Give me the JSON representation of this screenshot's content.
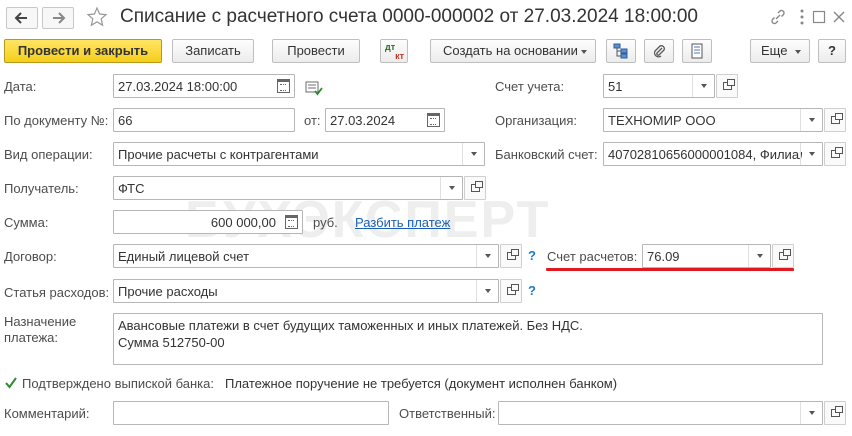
{
  "header": {
    "title": "Списание с расчетного счета 0000-000002 от 27.03.2024 18:00:00",
    "back_icon": "arrow-left-icon",
    "forward_icon": "arrow-right-icon",
    "favorite_icon": "star-icon",
    "link_icon": "link-icon",
    "more_icon": "vertical-dots-icon",
    "maximize_icon": "maximize-icon",
    "close_icon": "close-icon"
  },
  "toolbar": {
    "post_close_label": "Провести и закрыть",
    "write_label": "Записать",
    "post_label": "Провести",
    "dt_kt_label_top": "дт",
    "dt_kt_label_bottom": "кт",
    "create_based_label": "Создать на основании",
    "more_label": "Еще",
    "help_label": "?"
  },
  "form": {
    "date": {
      "label": "Дата:",
      "value": "27.03.2024 18:00:00"
    },
    "doc_number": {
      "label": "По документу №:",
      "value": "66"
    },
    "doc_date": {
      "label": "от:",
      "value": "27.03.2024"
    },
    "account": {
      "label": "Счет учета:",
      "value": "51"
    },
    "organization": {
      "label": "Организация:",
      "value": "ТЕХНОМИР ООО"
    },
    "operation_type": {
      "label": "Вид операции:",
      "value": "Прочие расчеты с контрагентами"
    },
    "bank_account": {
      "label": "Банковский счет:",
      "value": "40702810656000001084, Филиал"
    },
    "recipient": {
      "label": "Получатель:",
      "value": "ФТС"
    },
    "amount": {
      "label": "Сумма:",
      "value": "600 000,00",
      "currency": "руб.",
      "split_link": "Разбить платеж"
    },
    "contract": {
      "label": "Договор:",
      "value": "Единый лицевой счет",
      "help": "?"
    },
    "settlement_account": {
      "label": "Счет расчетов:",
      "value": "76.09"
    },
    "expense_item": {
      "label": "Статья расходов:",
      "value": "Прочие расходы",
      "help": "?"
    },
    "purpose": {
      "label_line1": "Назначение",
      "label_line2": "платежа:",
      "line1": "Авансовые платежи в счет будущих таможенных и иных платежей. Без НДС.",
      "line2": "Сумма 512750-00"
    },
    "bank_confirmed": {
      "label": "Подтверждено выпиской банка:",
      "checked": true,
      "note": "Платежное поручение не требуется (документ исполнен банком)"
    },
    "comment": {
      "label": "Комментарий:",
      "value": ""
    },
    "responsible": {
      "label": "Ответственный:",
      "value": ""
    }
  },
  "watermark": "БУХЭКСПЕРТ",
  "colors": {
    "accent_yellow": "#f5ce1a",
    "highlight_red": "#e0191f",
    "link_blue": "#1a5fb4",
    "check_green": "#2e8b2e"
  }
}
